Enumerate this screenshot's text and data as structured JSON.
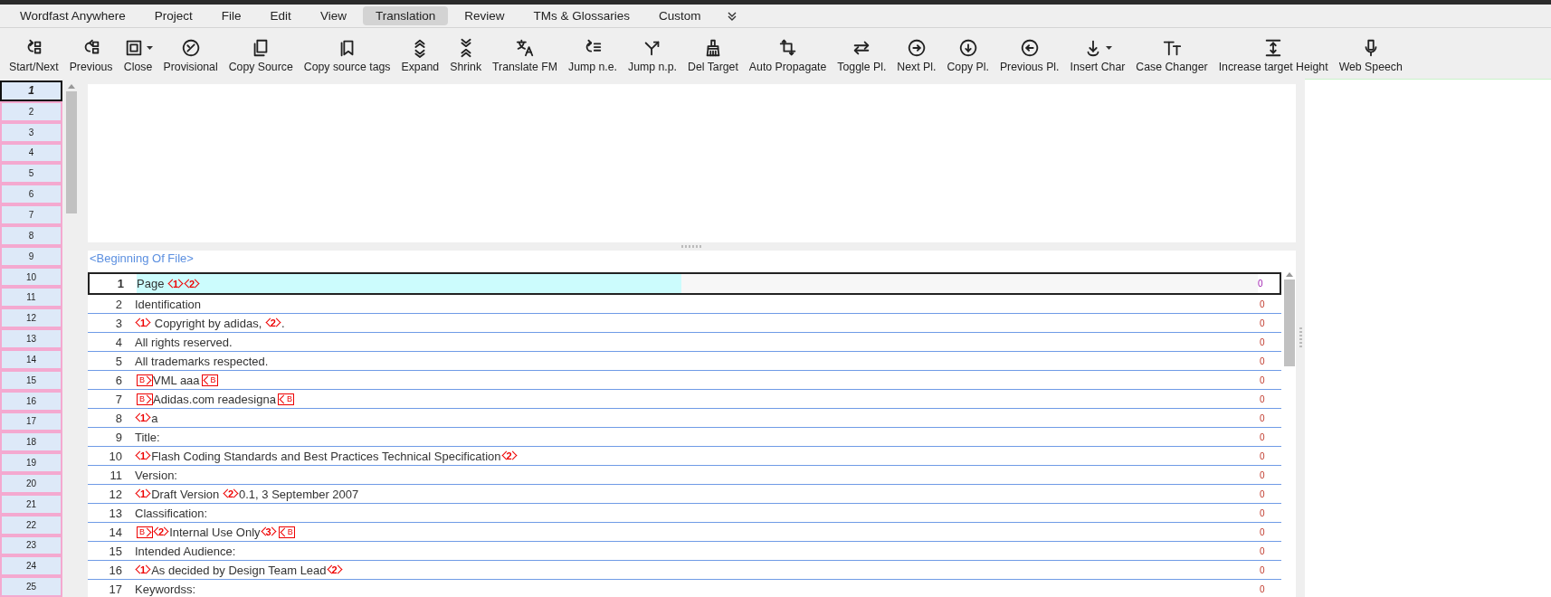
{
  "menu": [
    {
      "label": "Wordfast Anywhere",
      "selected": false
    },
    {
      "label": "Project",
      "selected": false
    },
    {
      "label": "File",
      "selected": false
    },
    {
      "label": "Edit",
      "selected": false
    },
    {
      "label": "View",
      "selected": false
    },
    {
      "label": "Translation",
      "selected": true
    },
    {
      "label": "Review",
      "selected": false
    },
    {
      "label": "TMs & Glossaries",
      "selected": false
    },
    {
      "label": "Custom",
      "selected": false
    }
  ],
  "toolbar": [
    {
      "label": "Start/Next",
      "dropdown": false
    },
    {
      "label": "Previous",
      "dropdown": false
    },
    {
      "label": "Close",
      "dropdown": true
    },
    {
      "label": "Provisional",
      "dropdown": false
    },
    {
      "label": "Copy Source",
      "dropdown": false
    },
    {
      "label": "Copy source tags",
      "dropdown": false
    },
    {
      "label": "Expand",
      "dropdown": false
    },
    {
      "label": "Shrink",
      "dropdown": false
    },
    {
      "label": "Translate FM",
      "dropdown": false
    },
    {
      "label": "Jump n.e.",
      "dropdown": false
    },
    {
      "label": "Jump n.p.",
      "dropdown": false
    },
    {
      "label": "Del Target",
      "dropdown": false
    },
    {
      "label": "Auto Propagate",
      "dropdown": false
    },
    {
      "label": "Toggle Pl.",
      "dropdown": false
    },
    {
      "label": "Next Pl.",
      "dropdown": false
    },
    {
      "label": "Copy Pl.",
      "dropdown": false
    },
    {
      "label": "Previous Pl.",
      "dropdown": false
    },
    {
      "label": "Insert Char",
      "dropdown": true
    },
    {
      "label": "Case Changer",
      "dropdown": false
    },
    {
      "label": "Increase target Height",
      "dropdown": false
    },
    {
      "label": "Web Speech",
      "dropdown": false
    }
  ],
  "navigator": [
    {
      "label": "1",
      "selected": true
    },
    {
      "label": "2",
      "selected": false
    },
    {
      "label": "3",
      "selected": false
    },
    {
      "label": "4",
      "selected": false
    },
    {
      "label": "5",
      "selected": false
    },
    {
      "label": "6",
      "selected": false
    },
    {
      "label": "7",
      "selected": false
    },
    {
      "label": "8",
      "selected": false
    },
    {
      "label": "9",
      "selected": false
    },
    {
      "label": "10",
      "selected": false
    },
    {
      "label": "11",
      "selected": false
    },
    {
      "label": "12",
      "selected": false
    },
    {
      "label": "13",
      "selected": false
    },
    {
      "label": "14",
      "selected": false
    },
    {
      "label": "15",
      "selected": false
    },
    {
      "label": "16",
      "selected": false
    },
    {
      "label": "17",
      "selected": false
    },
    {
      "label": "18",
      "selected": false
    },
    {
      "label": "19",
      "selected": false
    },
    {
      "label": "20",
      "selected": false
    },
    {
      "label": "21",
      "selected": false
    },
    {
      "label": "22",
      "selected": false
    },
    {
      "label": "23",
      "selected": false
    },
    {
      "label": "24",
      "selected": false
    },
    {
      "label": "25",
      "selected": false
    }
  ],
  "file_start": "<Beginning Of File>",
  "segments": [
    {
      "number": "1",
      "selected": true,
      "count": "0",
      "parts": [
        {
          "kind": "text",
          "text": "Page "
        },
        {
          "kind": "tag",
          "text": "1"
        },
        {
          "kind": "tag",
          "text": "2"
        }
      ]
    },
    {
      "number": "2",
      "selected": false,
      "count": "0",
      "parts": [
        {
          "kind": "text",
          "text": "Identification"
        }
      ]
    },
    {
      "number": "3",
      "selected": false,
      "count": "0",
      "parts": [
        {
          "kind": "tag",
          "text": "1"
        },
        {
          "kind": "text",
          "text": " Copyright by adidas, "
        },
        {
          "kind": "tag",
          "text": "2"
        },
        {
          "kind": "text",
          "text": "."
        }
      ]
    },
    {
      "number": "4",
      "selected": false,
      "count": "0",
      "parts": [
        {
          "kind": "text",
          "text": "All rights reserved."
        }
      ]
    },
    {
      "number": "5",
      "selected": false,
      "count": "0",
      "parts": [
        {
          "kind": "text",
          "text": "All trademarks respected."
        }
      ]
    },
    {
      "number": "6",
      "selected": false,
      "count": "0",
      "parts": [
        {
          "kind": "open-box",
          "text": "B"
        },
        {
          "kind": "text",
          "text": "VML aaa"
        },
        {
          "kind": "close-box",
          "text": "B"
        }
      ]
    },
    {
      "number": "7",
      "selected": false,
      "count": "0",
      "parts": [
        {
          "kind": "open-box",
          "text": "B"
        },
        {
          "kind": "text",
          "text": "Adidas.com readesigna"
        },
        {
          "kind": "close-box",
          "text": "B"
        }
      ]
    },
    {
      "number": "8",
      "selected": false,
      "count": "0",
      "parts": [
        {
          "kind": "tag",
          "text": "1"
        },
        {
          "kind": "text",
          "text": "a"
        }
      ]
    },
    {
      "number": "9",
      "selected": false,
      "count": "0",
      "parts": [
        {
          "kind": "text",
          "text": "Title:"
        }
      ]
    },
    {
      "number": "10",
      "selected": false,
      "count": "0",
      "parts": [
        {
          "kind": "tag",
          "text": "1"
        },
        {
          "kind": "text",
          "text": "Flash Coding Standards and Best Practices Technical Specification"
        },
        {
          "kind": "tag",
          "text": "2"
        }
      ]
    },
    {
      "number": "11",
      "selected": false,
      "count": "0",
      "parts": [
        {
          "kind": "text",
          "text": "Version:"
        }
      ]
    },
    {
      "number": "12",
      "selected": false,
      "count": "0",
      "parts": [
        {
          "kind": "tag",
          "text": "1"
        },
        {
          "kind": "text",
          "text": "Draft Version "
        },
        {
          "kind": "tag",
          "text": "2"
        },
        {
          "kind": "text",
          "text": "0.1, 3 September 2007"
        }
      ]
    },
    {
      "number": "13",
      "selected": false,
      "count": "0",
      "parts": [
        {
          "kind": "text",
          "text": "Classification:"
        }
      ]
    },
    {
      "number": "14",
      "selected": false,
      "count": "0",
      "parts": [
        {
          "kind": "open-box",
          "text": "B"
        },
        {
          "kind": "tag",
          "text": "2"
        },
        {
          "kind": "text",
          "text": "Internal Use Only"
        },
        {
          "kind": "tag",
          "text": "3"
        },
        {
          "kind": "close-box",
          "text": "B"
        }
      ]
    },
    {
      "number": "15",
      "selected": false,
      "count": "0",
      "parts": [
        {
          "kind": "text",
          "text": "Intended Audience:"
        }
      ]
    },
    {
      "number": "16",
      "selected": false,
      "count": "0",
      "parts": [
        {
          "kind": "tag",
          "text": "1"
        },
        {
          "kind": "text",
          "text": "As decided by Design Team Lead"
        },
        {
          "kind": "tag",
          "text": "2"
        }
      ]
    },
    {
      "number": "17",
      "selected": false,
      "count": "0",
      "parts": [
        {
          "kind": "text",
          "text": "Keywordss:"
        }
      ]
    }
  ]
}
